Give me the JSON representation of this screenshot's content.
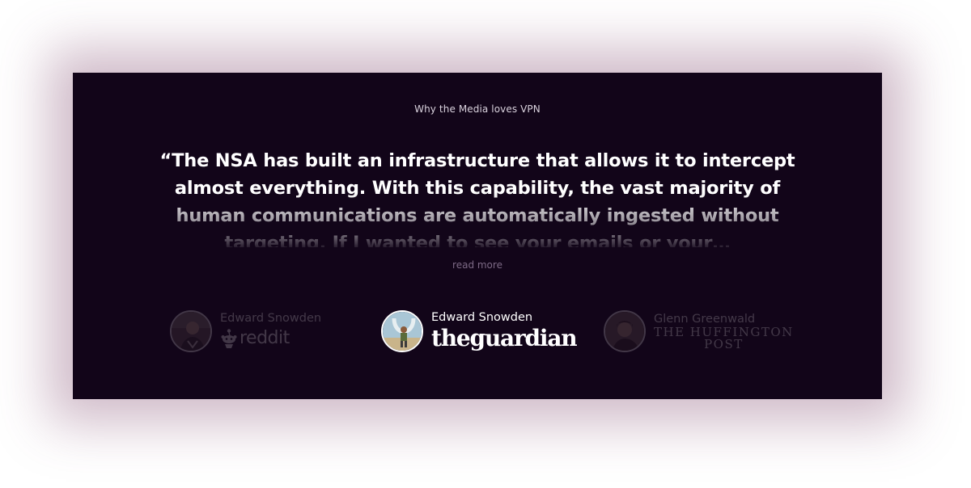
{
  "section": {
    "eyebrow": "Why the Media loves VPN"
  },
  "quote": {
    "text": "“The NSA has built an infrastructure that allows it to intercept almost everything. With this capability, the vast majority of human communications are automatically ingested without targeting. If I wanted to see your emails or your…",
    "read_more": "read more"
  },
  "sources": [
    {
      "name": "Edward Snowden",
      "outlet": "reddit",
      "active": false
    },
    {
      "name": "Edward Snowden",
      "outlet": "theguardian",
      "active": true
    },
    {
      "name": "Glenn Greenwald",
      "outlet_line1": "THE HUFFINGTON",
      "outlet_line2": "POST",
      "active": false
    }
  ],
  "colors": {
    "card_background": "#120519",
    "shadow": "#7a3c64",
    "text_primary": "#ffffff",
    "link": "#7d6a86"
  }
}
